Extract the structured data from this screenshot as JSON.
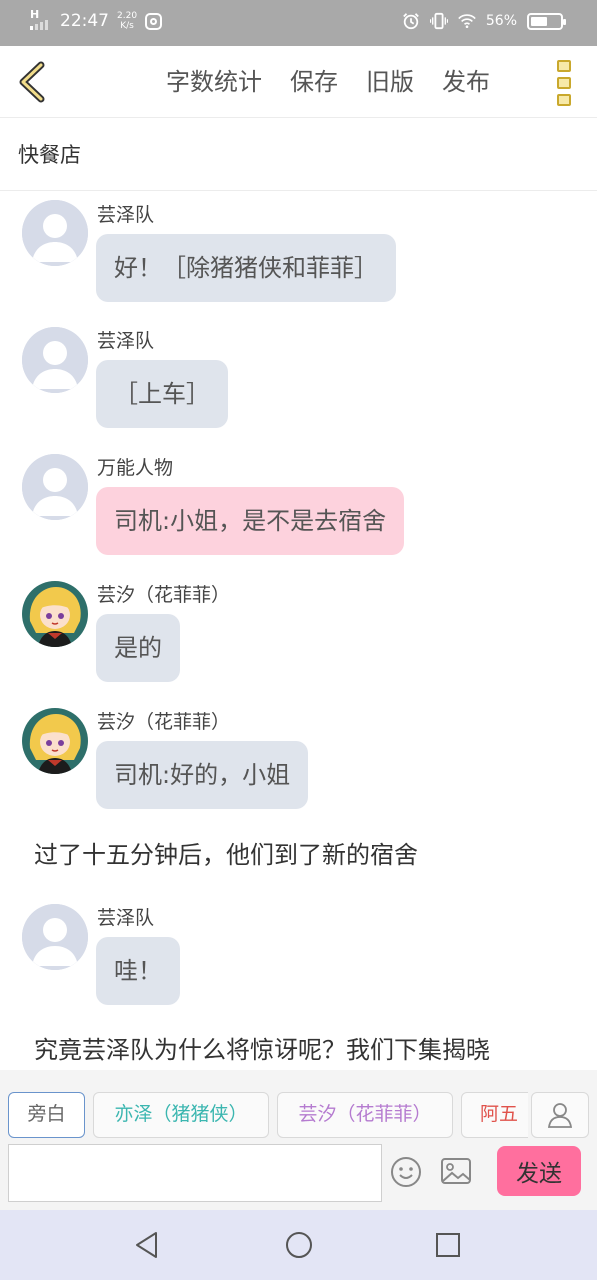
{
  "status_bar": {
    "signal": "H",
    "time": "22:47",
    "speed_value": "2.20",
    "speed_unit": "K/s",
    "battery_percent": "56%",
    "battery_level": 0.56
  },
  "toolbar": {
    "word_count_label": "字数统计",
    "save_label": "保存",
    "old_version_label": "旧版",
    "publish_label": "发布",
    "accent_color": "#c9a82c"
  },
  "story": {
    "title": "快餐店"
  },
  "messages": [
    {
      "type": "dialog",
      "sender": "芸泽队",
      "avatar": "default-avatar",
      "text": "好！［除猪猪侠和菲菲］",
      "bubble_color": "#dfe4ec"
    },
    {
      "type": "dialog",
      "sender": "芸泽队",
      "avatar": "default-avatar",
      "text": "［上车］",
      "bubble_color": "#dfe4ec"
    },
    {
      "type": "dialog",
      "sender": "万能人物",
      "avatar": "default-avatar",
      "text": "司机:小姐，是不是去宿舍",
      "bubble_color": "#fdd2dd"
    },
    {
      "type": "dialog",
      "sender": "芸汐（花菲菲）",
      "avatar": "character-avatar",
      "text": "是的",
      "bubble_color": "#dfe4ec"
    },
    {
      "type": "dialog",
      "sender": "芸汐（花菲菲）",
      "avatar": "character-avatar",
      "text": "司机:好的，小姐",
      "bubble_color": "#dfe4ec"
    },
    {
      "type": "narration",
      "text": "过了十五分钟后，他们到了新的宿舍"
    },
    {
      "type": "dialog",
      "sender": "芸泽队",
      "avatar": "default-avatar",
      "text": "哇！",
      "bubble_color": "#dfe4ec"
    },
    {
      "type": "narration",
      "text": "究竟芸泽队为什么将惊讶呢？我们下集揭晓"
    }
  ],
  "roles": [
    {
      "label": "旁白",
      "color": "#666666"
    },
    {
      "label": "亦泽（猪猪侠）",
      "color": "#3bb6b0"
    },
    {
      "label": "芸汐（花菲菲）",
      "color": "#b57bd0"
    },
    {
      "label": "阿五",
      "color": "#e0524b"
    }
  ],
  "input": {
    "value": "",
    "placeholder": "",
    "send_label": "发送",
    "send_color": "#ff6f9e"
  },
  "nav": {
    "back": "back-triangle-icon",
    "home": "home-circle-icon",
    "recent": "recent-square-icon"
  }
}
